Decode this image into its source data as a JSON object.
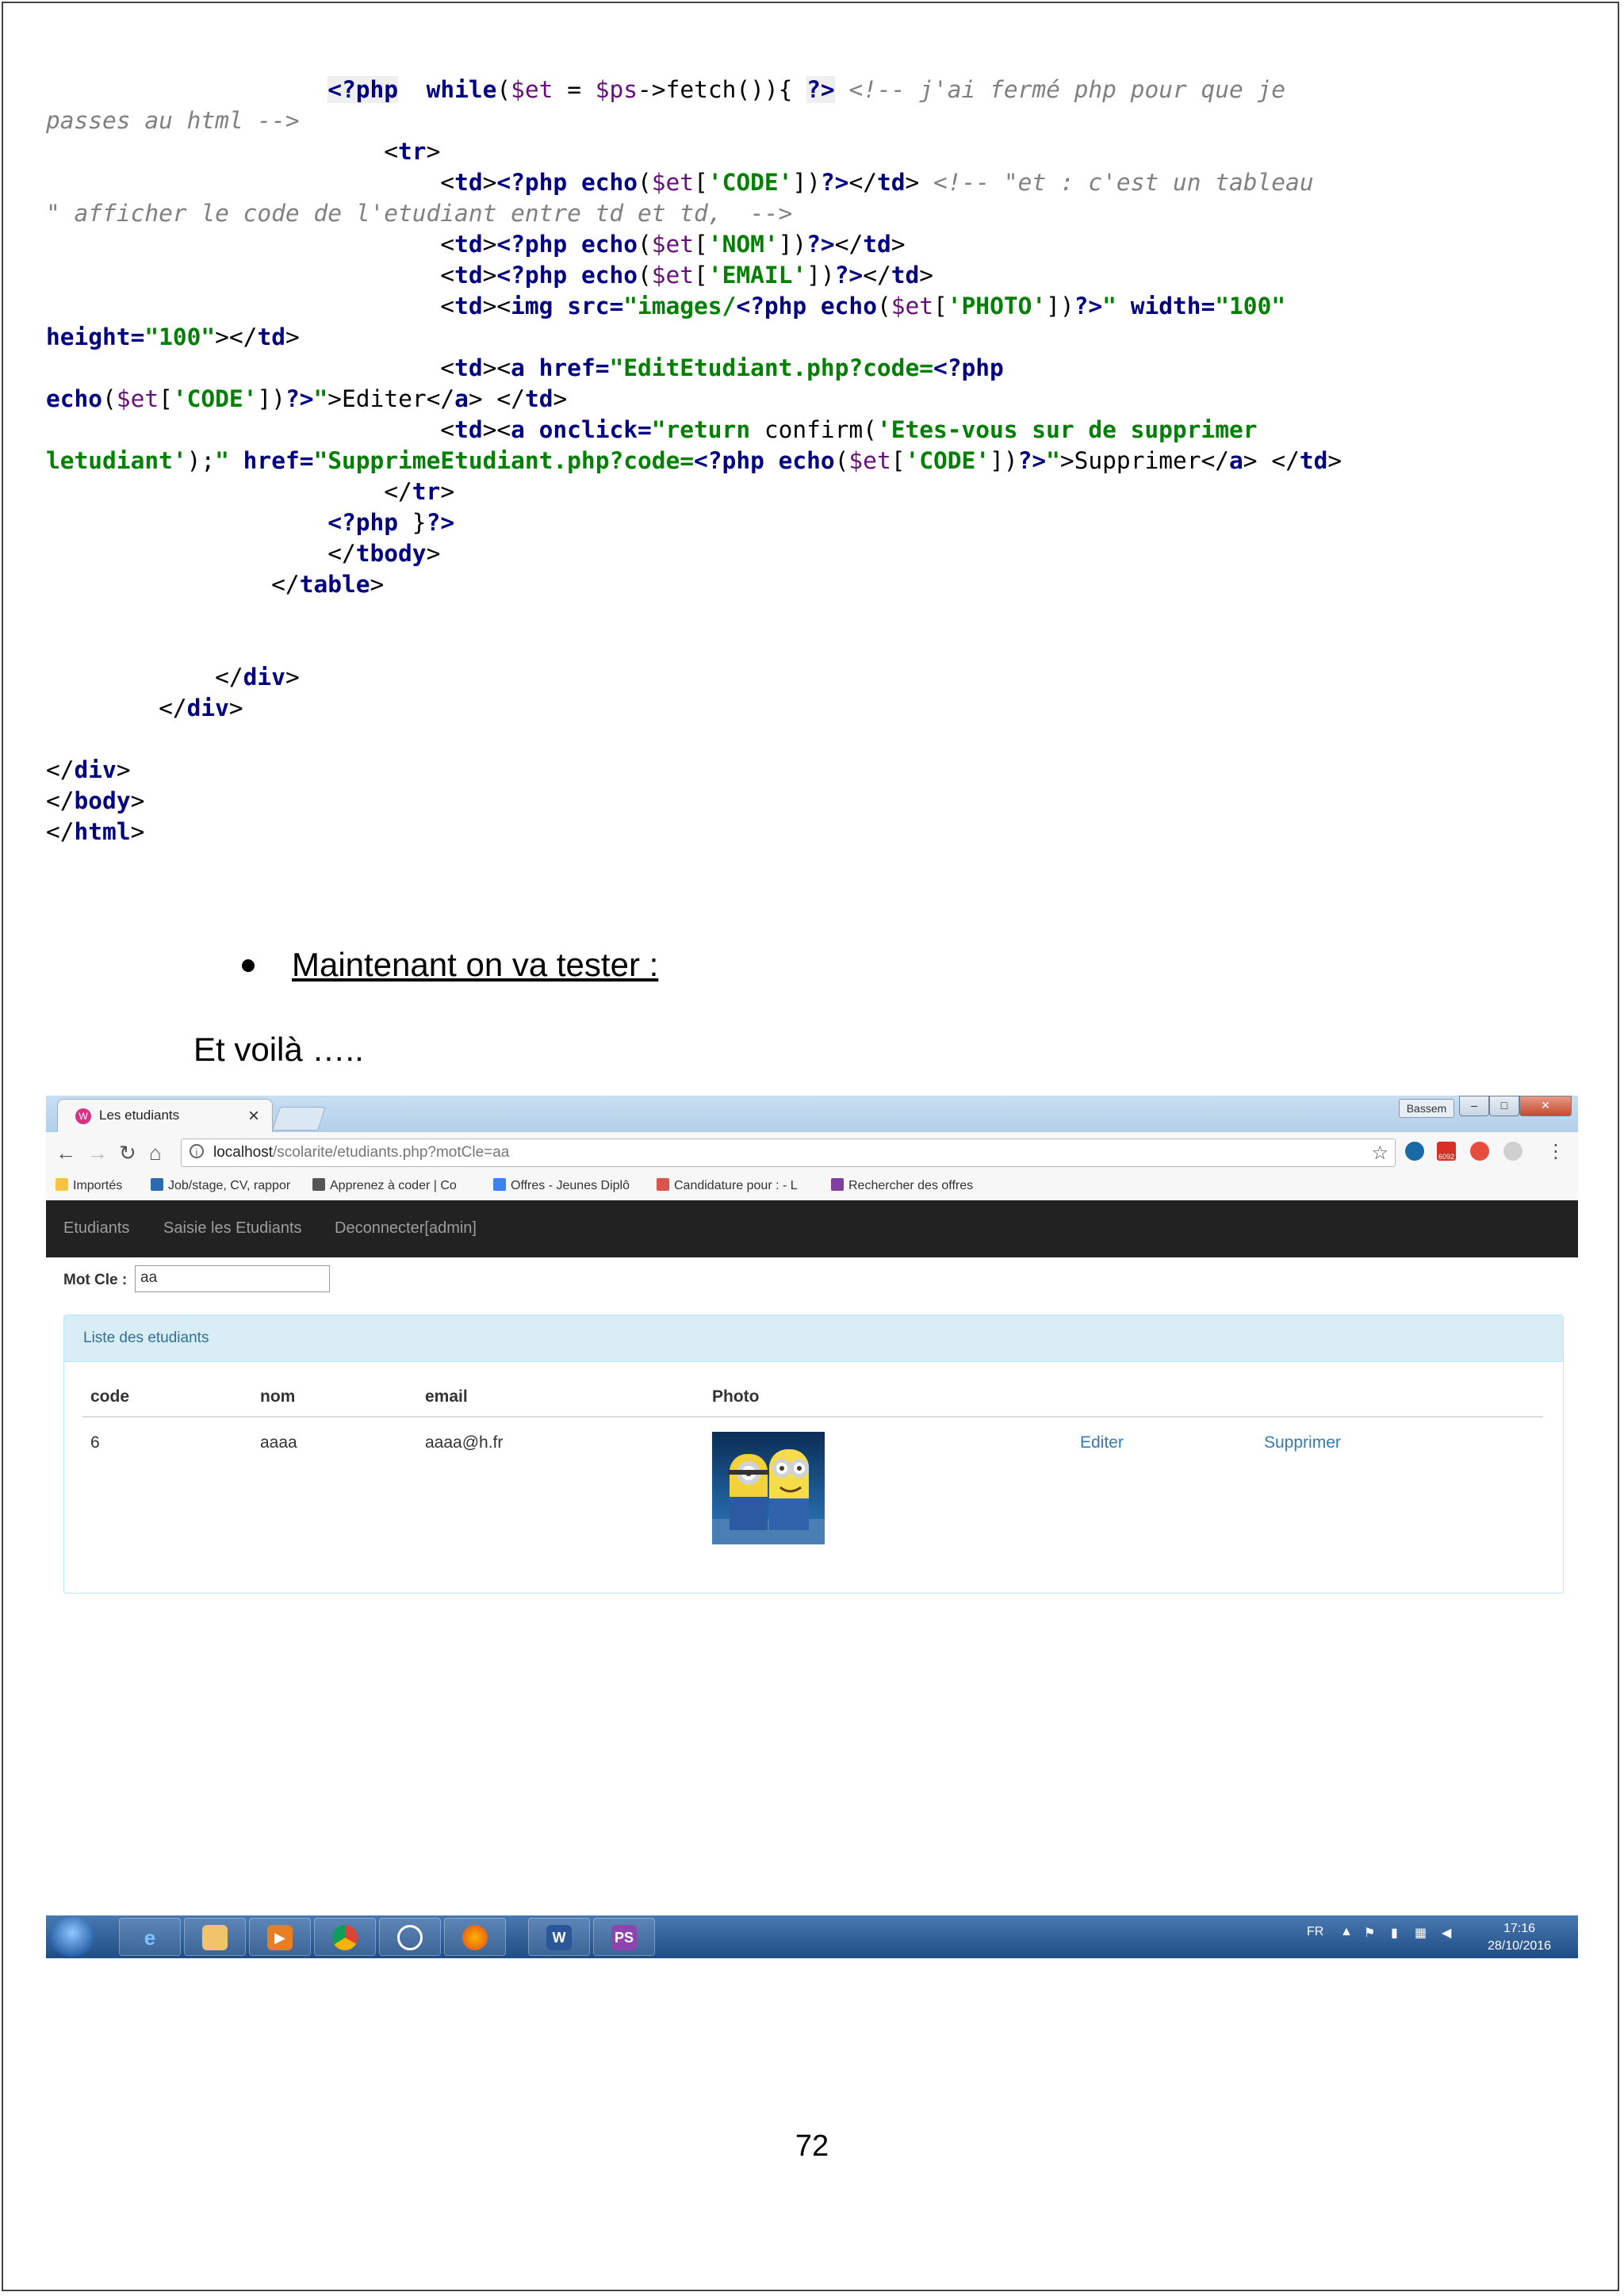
{
  "code_lines": [
    [
      {
        "t": "                    ",
        "c": ""
      },
      {
        "t": "<?php",
        "c": "kw hl"
      },
      {
        "t": "  ",
        "c": ""
      },
      {
        "t": "while",
        "c": "kw"
      },
      {
        "t": "(",
        "c": ""
      },
      {
        "t": "$et",
        "c": "var"
      },
      {
        "t": " = ",
        "c": ""
      },
      {
        "t": "$ps",
        "c": "var"
      },
      {
        "t": "->fetch()){ ",
        "c": ""
      },
      {
        "t": "?>",
        "c": "kw hl"
      },
      {
        "t": " ",
        "c": ""
      },
      {
        "t": "<!-- j'ai fermé php pour que je",
        "c": "cm"
      }
    ],
    [
      {
        "t": "passes au html -->",
        "c": "cm"
      }
    ],
    [
      {
        "t": "                        ",
        "c": ""
      },
      {
        "t": "<",
        "c": ""
      },
      {
        "t": "tr",
        "c": "kw"
      },
      {
        "t": ">",
        "c": ""
      }
    ],
    [
      {
        "t": "                            ",
        "c": ""
      },
      {
        "t": "<",
        "c": ""
      },
      {
        "t": "td",
        "c": "kw"
      },
      {
        "t": ">",
        "c": ""
      },
      {
        "t": "<?php",
        "c": "kw"
      },
      {
        "t": " ",
        "c": ""
      },
      {
        "t": "echo",
        "c": "kw"
      },
      {
        "t": "(",
        "c": ""
      },
      {
        "t": "$et",
        "c": "var"
      },
      {
        "t": "[",
        "c": ""
      },
      {
        "t": "'CODE'",
        "c": "str"
      },
      {
        "t": "])",
        "c": ""
      },
      {
        "t": "?>",
        "c": "kw"
      },
      {
        "t": "</",
        "c": ""
      },
      {
        "t": "td",
        "c": "kw"
      },
      {
        "t": "> ",
        "c": ""
      },
      {
        "t": "<!-- \"et : c'est un tableau",
        "c": "cm"
      }
    ],
    [
      {
        "t": "\" afficher le code de l'etudiant entre td et td,  -->",
        "c": "cm"
      }
    ],
    [
      {
        "t": "                            ",
        "c": ""
      },
      {
        "t": "<",
        "c": ""
      },
      {
        "t": "td",
        "c": "kw"
      },
      {
        "t": ">",
        "c": ""
      },
      {
        "t": "<?php",
        "c": "kw"
      },
      {
        "t": " ",
        "c": ""
      },
      {
        "t": "echo",
        "c": "kw"
      },
      {
        "t": "(",
        "c": ""
      },
      {
        "t": "$et",
        "c": "var"
      },
      {
        "t": "[",
        "c": ""
      },
      {
        "t": "'NOM'",
        "c": "str"
      },
      {
        "t": "])",
        "c": ""
      },
      {
        "t": "?>",
        "c": "kw"
      },
      {
        "t": "</",
        "c": ""
      },
      {
        "t": "td",
        "c": "kw"
      },
      {
        "t": ">",
        "c": ""
      }
    ],
    [
      {
        "t": "                            ",
        "c": ""
      },
      {
        "t": "<",
        "c": ""
      },
      {
        "t": "td",
        "c": "kw"
      },
      {
        "t": ">",
        "c": ""
      },
      {
        "t": "<?php",
        "c": "kw"
      },
      {
        "t": " ",
        "c": ""
      },
      {
        "t": "echo",
        "c": "kw"
      },
      {
        "t": "(",
        "c": ""
      },
      {
        "t": "$et",
        "c": "var"
      },
      {
        "t": "[",
        "c": ""
      },
      {
        "t": "'EMAIL'",
        "c": "str"
      },
      {
        "t": "])",
        "c": ""
      },
      {
        "t": "?>",
        "c": "kw"
      },
      {
        "t": "</",
        "c": ""
      },
      {
        "t": "td",
        "c": "kw"
      },
      {
        "t": ">",
        "c": ""
      }
    ],
    [
      {
        "t": "                            ",
        "c": ""
      },
      {
        "t": "<",
        "c": ""
      },
      {
        "t": "td",
        "c": "kw"
      },
      {
        "t": "><",
        "c": ""
      },
      {
        "t": "img",
        "c": "kw"
      },
      {
        "t": " ",
        "c": ""
      },
      {
        "t": "src=",
        "c": "kw"
      },
      {
        "t": "\"images/",
        "c": "str"
      },
      {
        "t": "<?php",
        "c": "kw"
      },
      {
        "t": " ",
        "c": ""
      },
      {
        "t": "echo",
        "c": "kw"
      },
      {
        "t": "(",
        "c": ""
      },
      {
        "t": "$et",
        "c": "var"
      },
      {
        "t": "[",
        "c": ""
      },
      {
        "t": "'PHOTO'",
        "c": "str"
      },
      {
        "t": "])",
        "c": ""
      },
      {
        "t": "?>",
        "c": "kw"
      },
      {
        "t": "\"",
        "c": "str"
      },
      {
        "t": " ",
        "c": ""
      },
      {
        "t": "width=",
        "c": "kw"
      },
      {
        "t": "\"100\"",
        "c": "str"
      }
    ],
    [
      {
        "t": "height=",
        "c": "kw"
      },
      {
        "t": "\"100\"",
        "c": "str"
      },
      {
        "t": "></",
        "c": ""
      },
      {
        "t": "td",
        "c": "kw"
      },
      {
        "t": ">",
        "c": ""
      }
    ],
    [
      {
        "t": "                            ",
        "c": ""
      },
      {
        "t": "<",
        "c": ""
      },
      {
        "t": "td",
        "c": "kw"
      },
      {
        "t": "><",
        "c": ""
      },
      {
        "t": "a",
        "c": "kw"
      },
      {
        "t": " ",
        "c": ""
      },
      {
        "t": "href=",
        "c": "kw"
      },
      {
        "t": "\"EditEtudiant.php?code=",
        "c": "str"
      },
      {
        "t": "<?php",
        "c": "kw"
      }
    ],
    [
      {
        "t": "echo",
        "c": "kw"
      },
      {
        "t": "(",
        "c": ""
      },
      {
        "t": "$et",
        "c": "var"
      },
      {
        "t": "[",
        "c": ""
      },
      {
        "t": "'CODE'",
        "c": "str"
      },
      {
        "t": "])",
        "c": ""
      },
      {
        "t": "?>",
        "c": "kw"
      },
      {
        "t": "\"",
        "c": "str"
      },
      {
        "t": ">Editer</",
        "c": ""
      },
      {
        "t": "a",
        "c": "kw"
      },
      {
        "t": "> </",
        "c": ""
      },
      {
        "t": "td",
        "c": "kw"
      },
      {
        "t": ">",
        "c": ""
      }
    ],
    [
      {
        "t": "                            ",
        "c": ""
      },
      {
        "t": "<",
        "c": ""
      },
      {
        "t": "td",
        "c": "kw"
      },
      {
        "t": "><",
        "c": ""
      },
      {
        "t": "a",
        "c": "kw"
      },
      {
        "t": " ",
        "c": ""
      },
      {
        "t": "onclick=",
        "c": "kw"
      },
      {
        "t": "\"return ",
        "c": "str"
      },
      {
        "t": "confirm",
        "c": "txt"
      },
      {
        "t": "(",
        "c": ""
      },
      {
        "t": "'Etes-vous sur de supprimer",
        "c": "str"
      }
    ],
    [
      {
        "t": "letudiant'",
        "c": "str"
      },
      {
        "t": ");",
        "c": ""
      },
      {
        "t": "\"",
        "c": "str"
      },
      {
        "t": " ",
        "c": ""
      },
      {
        "t": "href=",
        "c": "kw"
      },
      {
        "t": "\"SupprimeEtudiant.php?code=",
        "c": "str"
      },
      {
        "t": "<?php",
        "c": "kw"
      },
      {
        "t": " ",
        "c": ""
      },
      {
        "t": "echo",
        "c": "kw"
      },
      {
        "t": "(",
        "c": ""
      },
      {
        "t": "$et",
        "c": "var"
      },
      {
        "t": "[",
        "c": ""
      },
      {
        "t": "'CODE'",
        "c": "str"
      },
      {
        "t": "])",
        "c": ""
      },
      {
        "t": "?>",
        "c": "kw"
      },
      {
        "t": "\"",
        "c": "str"
      },
      {
        "t": ">Supprimer</",
        "c": ""
      },
      {
        "t": "a",
        "c": "kw"
      },
      {
        "t": "> </",
        "c": ""
      },
      {
        "t": "td",
        "c": "kw"
      },
      {
        "t": ">",
        "c": ""
      }
    ],
    [
      {
        "t": "                        ",
        "c": ""
      },
      {
        "t": "</",
        "c": ""
      },
      {
        "t": "tr",
        "c": "kw"
      },
      {
        "t": ">",
        "c": ""
      }
    ],
    [
      {
        "t": "                    ",
        "c": ""
      },
      {
        "t": "<?php",
        "c": "kw"
      },
      {
        "t": " }",
        "c": ""
      },
      {
        "t": "?>",
        "c": "kw"
      }
    ],
    [
      {
        "t": "                    ",
        "c": ""
      },
      {
        "t": "</",
        "c": ""
      },
      {
        "t": "tbody",
        "c": "kw"
      },
      {
        "t": ">",
        "c": ""
      }
    ],
    [
      {
        "t": "                ",
        "c": ""
      },
      {
        "t": "</",
        "c": ""
      },
      {
        "t": "table",
        "c": "kw"
      },
      {
        "t": ">",
        "c": ""
      }
    ],
    [
      {
        "t": "",
        "c": ""
      }
    ],
    [
      {
        "t": "",
        "c": ""
      }
    ],
    [
      {
        "t": "            ",
        "c": ""
      },
      {
        "t": "</",
        "c": ""
      },
      {
        "t": "div",
        "c": "kw"
      },
      {
        "t": ">",
        "c": ""
      }
    ],
    [
      {
        "t": "        ",
        "c": ""
      },
      {
        "t": "</",
        "c": ""
      },
      {
        "t": "div",
        "c": "kw"
      },
      {
        "t": ">",
        "c": ""
      }
    ],
    [
      {
        "t": "",
        "c": ""
      }
    ],
    [
      {
        "t": "</",
        "c": ""
      },
      {
        "t": "div",
        "c": "kw"
      },
      {
        "t": ">",
        "c": ""
      }
    ],
    [
      {
        "t": "</",
        "c": ""
      },
      {
        "t": "body",
        "c": "kw"
      },
      {
        "t": ">",
        "c": ""
      }
    ],
    [
      {
        "t": "</",
        "c": ""
      },
      {
        "t": "html",
        "c": "kw"
      },
      {
        "t": ">",
        "c": ""
      }
    ]
  ],
  "bullet": {
    "text": "Maintenant on va tester :"
  },
  "voila": "Et voilà …..",
  "page_number": "72",
  "browser": {
    "tab_title": "Les etudiants",
    "user_chip": "Bassem",
    "url_host": "localhost",
    "url_path": "/scolarite/etudiants.php?motCle=aa",
    "bookmarks": [
      {
        "label": "Importés",
        "color": "#f5c542"
      },
      {
        "label": "Job/stage, CV, rappor",
        "color": "#2b6cb0"
      },
      {
        "label": "Apprenez à coder | Co",
        "color": "#555555"
      },
      {
        "label": "Offres - Jeunes Diplô",
        "color": "#3b82f6"
      },
      {
        "label": "Candidature pour : - L",
        "color": "#d9534f"
      },
      {
        "label": "Rechercher des offres",
        "color": "#7e3fa0"
      }
    ],
    "gmail_badge": "6092"
  },
  "app": {
    "nav": [
      "Etudiants",
      "Saisie les Etudiants",
      "Deconnecter[admin]"
    ],
    "search_label": "Mot Cle :",
    "search_value": "aa",
    "panel_title": "Liste des etudiants",
    "columns": [
      "code",
      "nom",
      "email",
      "Photo"
    ],
    "rows": [
      {
        "code": "6",
        "nom": "aaaa",
        "email": "aaaa@h.fr",
        "edit": "Editer",
        "delete": "Supprimer"
      }
    ]
  },
  "taskbar": {
    "lang": "FR",
    "time": "17:16",
    "date": "28/10/2016",
    "apps": [
      "ie",
      "explorer",
      "media",
      "chrome",
      "app",
      "firefox",
      "word",
      "phpstorm"
    ]
  },
  "colors": {
    "keyword": "#000080",
    "string": "#008000",
    "comment": "#808080",
    "navbar": "#222222",
    "link": "#337ab7",
    "panel_heading": "#d9edf7"
  }
}
